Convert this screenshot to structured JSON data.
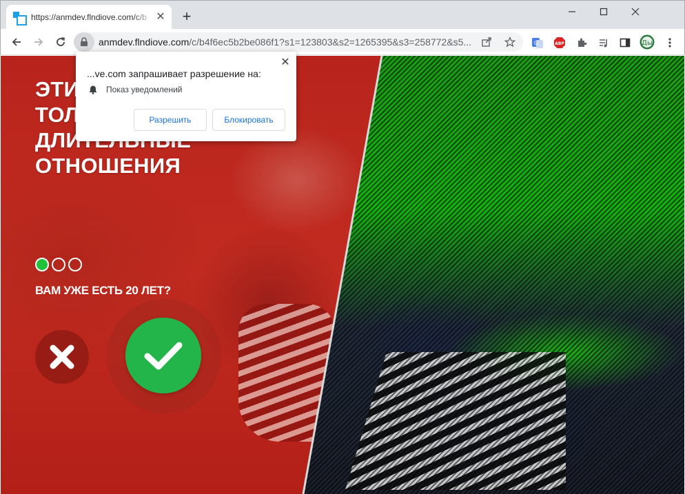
{
  "browser": {
    "tab_title": "https://anmdev.flndiove.com/c/b",
    "tab_close": "✕",
    "new_tab": "+",
    "url_host": "anmdev.flndiove.com",
    "url_path": "/c/b4f6ec5b2be086f1?s1=123803&s2=1265395&s3=258772&s5...",
    "extension_abp_label": "ABP",
    "profile_initials": "Ды"
  },
  "permission_popup": {
    "title": "...ve.com запрашивает разрешение на:",
    "permission": "Показ уведомлений",
    "allow_label": "Разрешить",
    "block_label": "Блокировать",
    "close": "✕"
  },
  "page": {
    "headline_lines": [
      "ЭТИ",
      "ТОЛ",
      "ДЛИТЕЛЬНЫЕ",
      "ОТНОШЕНИЯ"
    ],
    "question": "ВАМ УЖЕ ЕСТЬ 20 ЛЕТ?",
    "steps_total": 3,
    "step_current": 1,
    "colors": {
      "accent_green": "#24b54a",
      "step_active": "#1fc23a",
      "left_panel_red": "#c0201a"
    }
  }
}
